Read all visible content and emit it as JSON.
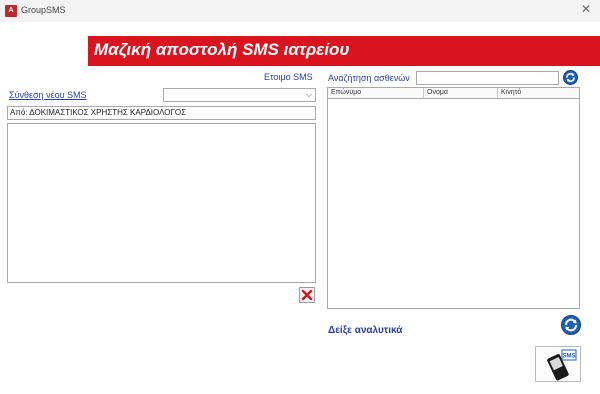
{
  "window": {
    "title": "GroupSMS",
    "app_icon_label": "A",
    "close_glyph": "✕"
  },
  "banner": {
    "title": "Μαζική αποστολή SMS ιατρείου",
    "color": "#d9141f"
  },
  "compose": {
    "ready_label": "Ετοιμο SMS",
    "compose_label": "Σύνθεση νέου SMS",
    "template_select_value": "",
    "from_text": "Από: ΔΟΚΙΜΑΣΤΙΚΟΣ ΧΡΗΣΤΗΣ ΚΑΡΔΙΟΛΟΓΟΣ",
    "message_value": ""
  },
  "search": {
    "label": "Αναζήτηση ασθενών",
    "value": ""
  },
  "patients_grid": {
    "columns": [
      "Επώνυμο",
      "Ονομα",
      "Κινητό"
    ],
    "rows": []
  },
  "details_label": "Δείξε αναλυτικά",
  "icons": {
    "clear": "red-x-icon",
    "search": "refresh-arrows-icon",
    "refresh": "refresh-arrows-icon",
    "send": "sms-phone-icon",
    "sms_badge": "SMS"
  },
  "colors": {
    "accent_blue": "#2b3f9e",
    "button_blue": "#1f5fb8",
    "delete_red": "#d9141f"
  }
}
